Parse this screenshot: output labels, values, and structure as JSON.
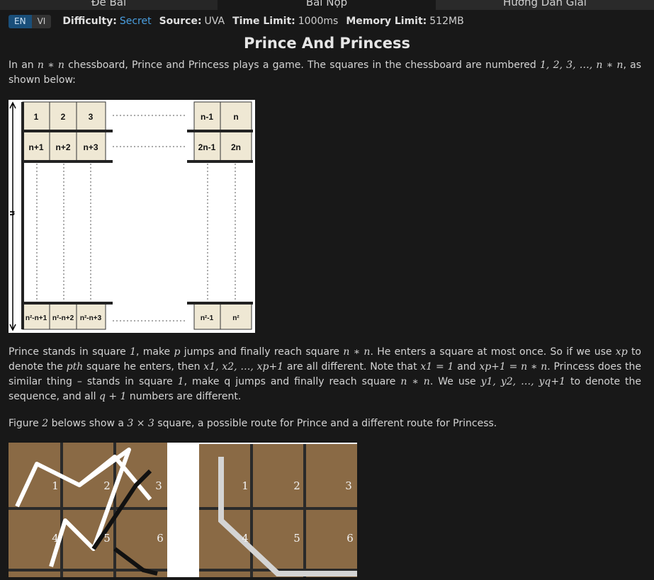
{
  "tabs": [
    {
      "label": "Đề Bài"
    },
    {
      "label": "Bài Nộp"
    },
    {
      "label": "Hướng Dẫn Giải"
    }
  ],
  "lang": {
    "en": "EN",
    "vi": "VI"
  },
  "meta": {
    "difficulty_label": "Difficulty:",
    "difficulty": "Secret",
    "source_label": "Source:",
    "source": "UVA",
    "time_label": "Time Limit:",
    "time": "1000ms",
    "memory_label": "Memory Limit:",
    "memory": "512MB"
  },
  "title": "Prince And Princess",
  "para1": {
    "a": "In an ",
    "m1": "n ∗ n",
    "b": " chessboard, Prince and Princess plays a game. The squares in the chessboard are numbered ",
    "m2": "1, 2, 3, …, n ∗ n",
    "c": ", as shown below:"
  },
  "figure1": {
    "cells_top": [
      "1",
      "2",
      "3",
      "n-1",
      "n"
    ],
    "cells_row2": [
      "n+1",
      "n+2",
      "n+3",
      "2n-1",
      "2n"
    ],
    "cells_bottom": [
      "n²-n+1",
      "n²-n+2",
      "n²-n+3",
      "n²-1",
      "n²"
    ],
    "side_label": "n"
  },
  "para2": {
    "a": "Prince stands in square ",
    "m1": "1",
    "b": ", make ",
    "m2": "p",
    "c": " jumps and finally reach square ",
    "m3": "n ∗ n",
    "d": ". He enters a square at most once. So if we use ",
    "m4": "xp",
    "e": " to denote the ",
    "m5": "pth",
    "f": " square he enters, then ",
    "m6": "x1, x2, …, xp+1",
    "g": " are all different. Note that ",
    "m7": "x1 = 1",
    "h": " and ",
    "m8": "xp+1 = n ∗ n",
    "i": ". Princess does the similar thing – stands in square ",
    "m9": "1",
    "j": ", make q jumps and finally reach square ",
    "m10": "n ∗ n",
    "k": ". We use ",
    "m11": "y1, y2, …, yq+1",
    "l": " to denote the sequence, and all ",
    "m12": "q + 1",
    "n": " numbers are different."
  },
  "para3": {
    "a": "Figure ",
    "m1": "2",
    "b": " belows show a ",
    "m2": "3 × 3",
    "c": " square, a possible route for Prince and a different route for Princess."
  },
  "figure2": {
    "left_numbers": [
      "1",
      "2",
      "3",
      "4",
      "5",
      "6"
    ],
    "right_numbers": [
      "1",
      "2",
      "3",
      "4",
      "5",
      "6"
    ]
  },
  "colors": {
    "accent": "#4a9fe0",
    "lang_active": "#1a4f7a",
    "tile": "#efe8d4",
    "board": "#8a6a45"
  }
}
